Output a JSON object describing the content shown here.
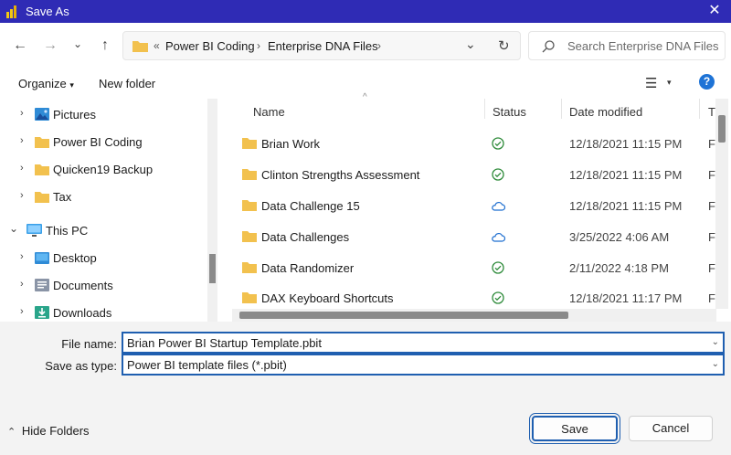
{
  "window": {
    "title": "Save As",
    "close_glyph": "✕",
    "title_bar_color": "#2f2bb5"
  },
  "address": {
    "back_glyph": "←",
    "forward_glyph": "→",
    "history_glyph": "⌄",
    "up_glyph": "↑",
    "breadcrumb_overflow": "«",
    "breadcrumbs": [
      "Power BI Coding",
      "Enterprise DNA Files"
    ],
    "separator": "›",
    "dropdown_glyph": "⌄",
    "refresh_glyph": "↻",
    "search_placeholder": "Search Enterprise DNA Files"
  },
  "toolbar": {
    "organize_label": "Organize",
    "organize_caret": "▾",
    "new_folder_label": "New folder",
    "view_glyph": "☰",
    "view_caret": "▾",
    "help_glyph": "?"
  },
  "nav_pane": {
    "items": [
      {
        "label": "Pictures",
        "icon": "pictures-folder-icon"
      },
      {
        "label": "Power BI Coding",
        "icon": "folder-icon"
      },
      {
        "label": "Quicken19 Backup",
        "icon": "folder-icon"
      },
      {
        "label": "Tax",
        "icon": "folder-icon"
      },
      {
        "label": "This PC",
        "icon": "pc-icon"
      },
      {
        "label": "Desktop",
        "icon": "desktop-folder-icon"
      },
      {
        "label": "Documents",
        "icon": "documents-folder-icon"
      },
      {
        "label": "Downloads",
        "icon": "downloads-folder-icon"
      }
    ],
    "collapsed_glyph": "›",
    "expanded_glyph": "⌄"
  },
  "columns": {
    "name": "Name",
    "status": "Status",
    "date_modified": "Date modified",
    "type": "T",
    "sort_glyph": "^"
  },
  "files": [
    {
      "name": "Brian Work",
      "status": "synced",
      "date": "12/18/2021 11:15 PM",
      "type": "F"
    },
    {
      "name": "Clinton Strengths Assessment",
      "status": "synced",
      "date": "12/18/2021 11:15 PM",
      "type": "F"
    },
    {
      "name": "Data Challenge 15",
      "status": "cloud",
      "date": "12/18/2021 11:15 PM",
      "type": "F"
    },
    {
      "name": "Data Challenges",
      "status": "cloud",
      "date": "3/25/2022 4:06 AM",
      "type": "F"
    },
    {
      "name": "Data Randomizer",
      "status": "synced",
      "date": "2/11/2022 4:18 PM",
      "type": "F"
    },
    {
      "name": "DAX Keyboard Shortcuts",
      "status": "synced",
      "date": "12/18/2021 11:17 PM",
      "type": "F"
    }
  ],
  "form": {
    "file_name_label": "File name:",
    "file_name_value": "Brian Power BI Startup Template.pbit",
    "save_type_label": "Save as type:",
    "save_type_value": "Power BI template files (*.pbit)",
    "dropdown_glyph": "⌄"
  },
  "footer": {
    "hide_folders_glyph": "⌃",
    "hide_folders_label": "Hide Folders",
    "save_label": "Save",
    "cancel_label": "Cancel"
  },
  "colors": {
    "accent": "#1f5fb0",
    "folder": "#f2c14e",
    "synced": "#2e8b3a",
    "cloud": "#1f6fd0"
  }
}
